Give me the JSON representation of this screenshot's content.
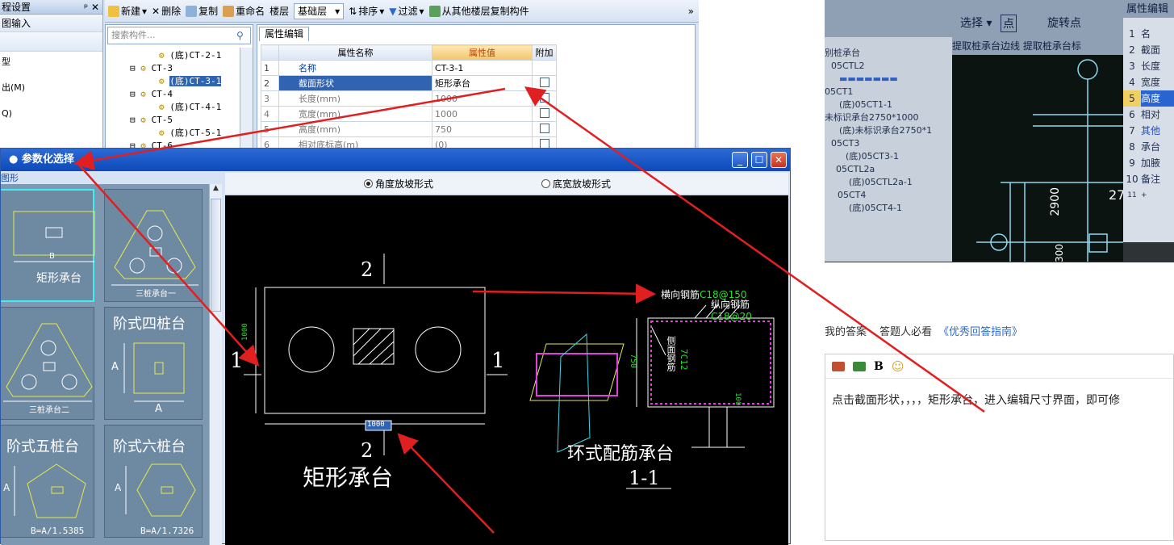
{
  "leftnav": {
    "header": "程设置",
    "row1": "图输入",
    "items": [
      "型",
      "出(M)",
      "Q)"
    ]
  },
  "toolbar": {
    "new": "新建",
    "delete": "删除",
    "copy": "复制",
    "rename": "重命名",
    "floor_label": "楼层",
    "floor_value": "基础层",
    "sort": "排序",
    "filter": "过滤",
    "copy_from": "从其他楼层复制构件",
    "more": "»"
  },
  "tree": {
    "search_placeholder": "搜索构件...",
    "nodes": [
      "(底)CT-2-1",
      "CT-3",
      "(底)CT-3-1",
      "CT-4",
      "(底)CT-4-1",
      "CT-5",
      "(底)CT-5-1",
      "CT-6"
    ]
  },
  "props": {
    "tab": "属性编辑",
    "headers": [
      "属性名称",
      "属性值",
      "附加"
    ],
    "rows": [
      {
        "no": "1",
        "name": "名称",
        "value": "CT-3-1"
      },
      {
        "no": "2",
        "name": "截面形状",
        "value": "矩形承台"
      },
      {
        "no": "3",
        "name": "长度(mm)",
        "value": "1000"
      },
      {
        "no": "4",
        "name": "宽度(mm)",
        "value": "1000"
      },
      {
        "no": "5",
        "name": "高度(mm)",
        "value": "750"
      },
      {
        "no": "6",
        "name": "相对底标高(m)",
        "value": "(0)"
      }
    ]
  },
  "dialog": {
    "title": "参数化选择",
    "group_label": "图形",
    "radio1": "角度放坡形式",
    "radio2": "底宽放坡形式",
    "thumbs": {
      "t1": "矩形承台",
      "t2": "三桩承台一",
      "t3": "三桩承台二",
      "t4": "阶式四桩台",
      "t5": "阶式五桩台",
      "t6": "阶式六桩台",
      "b": "B",
      "a": "A",
      "f5": "B=A/1.5385",
      "f6": "B=A/1.7326"
    },
    "drawing": {
      "sec2": "2",
      "sec1": "1",
      "dim_len": "1000",
      "dim_w": "1000",
      "dim_h": "750",
      "dim_side": "100",
      "name": "矩形承台",
      "ring": "环式配筋承台",
      "sec11": "1-1",
      "hbar": "横向钢筋",
      "hbar_val": "C18@150",
      "vbar": "纵向钢筋",
      "vbar_val": "C18@20",
      "side": "侧面钢筋",
      "side_val": "7C12"
    }
  },
  "photo": {
    "tb_select": "选择",
    "tb_point": "点",
    "tb_rotate": "旋转点",
    "panel": "属性编辑",
    "extract1": "提取桩承台边线",
    "extract2": "提取桩承台标",
    "tree": [
      "别桩承台",
      "05CTL2",
      "05CT1",
      "(底)05CT1-1",
      "未标识承台2750*1000",
      "(底)未标识承台2750*1",
      "05CT3",
      "(底)05CT3-1",
      "05CTL2a",
      "(底)05CTL2a-1",
      "05CT4",
      "(底)05CT4-1"
    ],
    "rownums": [
      "1",
      "2",
      "3",
      "4",
      "5",
      "6",
      "7",
      "8",
      "9",
      "10",
      "11"
    ],
    "rowvals": [
      "名",
      "截面",
      "长度",
      "宽度",
      "高度",
      "相对",
      "其他",
      "承台",
      "加腋",
      "备注",
      "+"
    ],
    "d1": "2900",
    "d2": "27",
    "d3": "300"
  },
  "answer": {
    "my_answer": "我的答案",
    "must_read": "答题人必看",
    "guide": "《优秀回答指南》",
    "bold": "B",
    "text": "点击截面形状，，，，矩形承台，进入编辑尺寸界面，即可修"
  },
  "colors": {
    "arrow": "#e02020",
    "cad_line": "#ffffff",
    "cad_yellow": "#e8e84a",
    "cad_green": "#33dd33",
    "cad_magenta": "#e040e0",
    "cad_cyan": "#40d8e8",
    "title_blue": "#0d49b9"
  }
}
